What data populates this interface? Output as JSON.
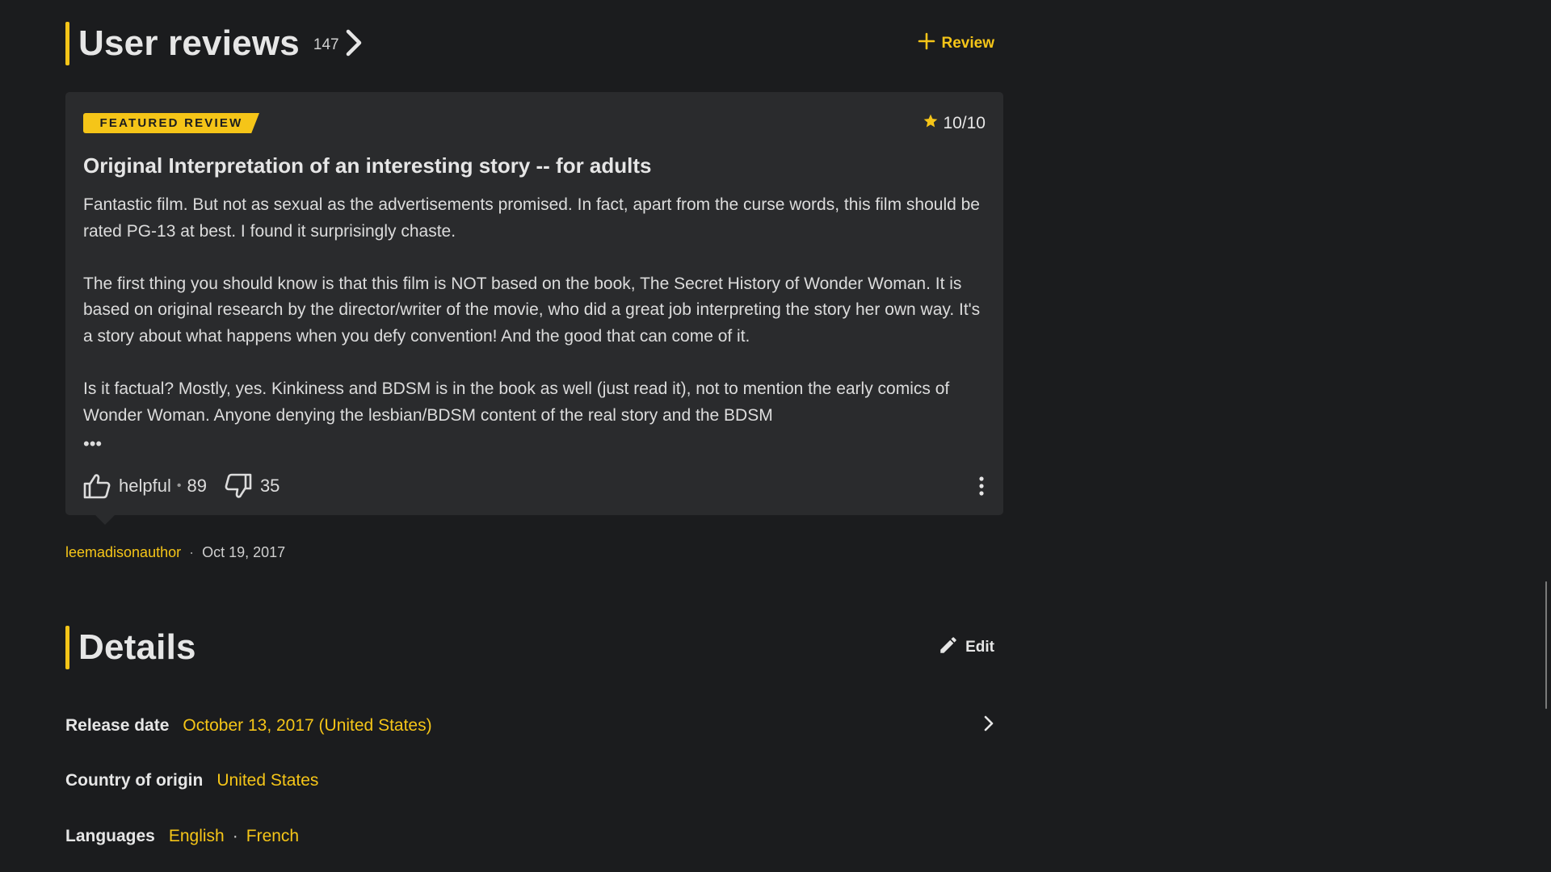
{
  "reviews": {
    "title": "User reviews",
    "count": "147",
    "add_label": "Review",
    "featured": {
      "badge": "FEATURED REVIEW",
      "rating": "10/10",
      "title": "Original Interpretation of an interesting story -- for adults",
      "paragraphs": [
        "Fantastic film. But not as sexual as the advertisements promised. In fact, apart from the curse words, this film should be rated PG-13 at best. I found it surprisingly chaste.",
        "The first thing you should know is that this film is NOT based on the book, The Secret History of Wonder Woman. It is based on original research by the director/writer of the movie, who did a great job interpreting the story her own way. It's a story about what happens when you defy convention! And the good that can come of it.",
        "Is it factual? Mostly, yes. Kinkiness and BDSM is in the book as well (just read it), not to mention the early comics of Wonder Woman. Anyone denying the lesbian/BDSM content of the real story and the BDSM"
      ],
      "more_symbol": "•••",
      "helpful_label": "helpful",
      "helpful_sep": "•",
      "helpful_count": "89",
      "unhelpful_count": "35",
      "author": "leemadisonauthor",
      "date_sep": "·",
      "date": "Oct 19, 2017"
    }
  },
  "details": {
    "title": "Details",
    "edit_label": "Edit",
    "release_date_label": "Release date",
    "release_date_value": "October 13, 2017 (United States)",
    "country_label": "Country of origin",
    "country_value": "United States",
    "languages_label": "Languages",
    "languages": [
      "English",
      "French"
    ],
    "languages_sep": "·"
  },
  "colors": {
    "accent": "#f5c518",
    "background": "#1b1c1e",
    "card": "#2a2b2d",
    "text": "#e6e6e6"
  },
  "icons": [
    "chevron-right-icon",
    "plus-icon",
    "star-icon",
    "thumb-up-icon",
    "thumb-down-icon",
    "more-vertical-icon",
    "pencil-icon"
  ]
}
